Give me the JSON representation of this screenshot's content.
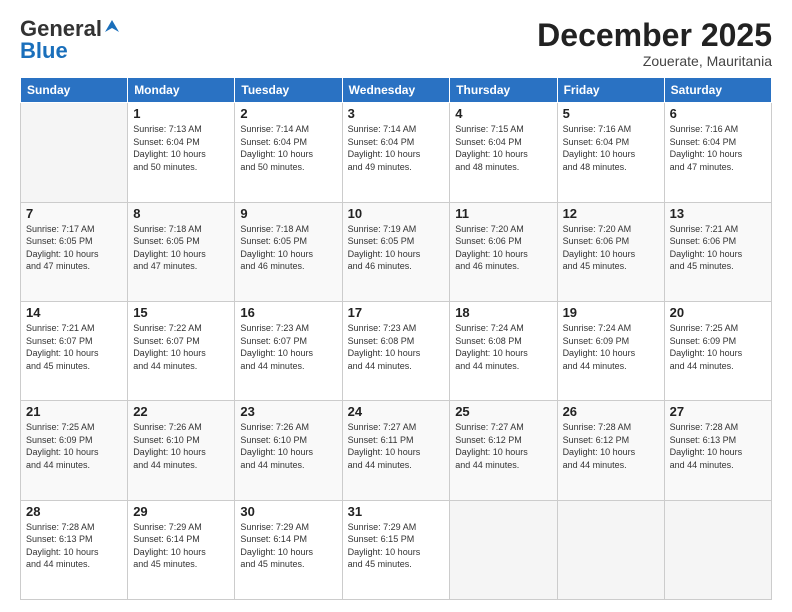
{
  "header": {
    "logo_general": "General",
    "logo_blue": "Blue",
    "month_title": "December 2025",
    "subtitle": "Zouerate, Mauritania"
  },
  "days_of_week": [
    "Sunday",
    "Monday",
    "Tuesday",
    "Wednesday",
    "Thursday",
    "Friday",
    "Saturday"
  ],
  "weeks": [
    [
      {
        "day": "",
        "info": ""
      },
      {
        "day": "1",
        "info": "Sunrise: 7:13 AM\nSunset: 6:04 PM\nDaylight: 10 hours\nand 50 minutes."
      },
      {
        "day": "2",
        "info": "Sunrise: 7:14 AM\nSunset: 6:04 PM\nDaylight: 10 hours\nand 50 minutes."
      },
      {
        "day": "3",
        "info": "Sunrise: 7:14 AM\nSunset: 6:04 PM\nDaylight: 10 hours\nand 49 minutes."
      },
      {
        "day": "4",
        "info": "Sunrise: 7:15 AM\nSunset: 6:04 PM\nDaylight: 10 hours\nand 48 minutes."
      },
      {
        "day": "5",
        "info": "Sunrise: 7:16 AM\nSunset: 6:04 PM\nDaylight: 10 hours\nand 48 minutes."
      },
      {
        "day": "6",
        "info": "Sunrise: 7:16 AM\nSunset: 6:04 PM\nDaylight: 10 hours\nand 47 minutes."
      }
    ],
    [
      {
        "day": "7",
        "info": "Sunrise: 7:17 AM\nSunset: 6:05 PM\nDaylight: 10 hours\nand 47 minutes."
      },
      {
        "day": "8",
        "info": "Sunrise: 7:18 AM\nSunset: 6:05 PM\nDaylight: 10 hours\nand 47 minutes."
      },
      {
        "day": "9",
        "info": "Sunrise: 7:18 AM\nSunset: 6:05 PM\nDaylight: 10 hours\nand 46 minutes."
      },
      {
        "day": "10",
        "info": "Sunrise: 7:19 AM\nSunset: 6:05 PM\nDaylight: 10 hours\nand 46 minutes."
      },
      {
        "day": "11",
        "info": "Sunrise: 7:20 AM\nSunset: 6:06 PM\nDaylight: 10 hours\nand 46 minutes."
      },
      {
        "day": "12",
        "info": "Sunrise: 7:20 AM\nSunset: 6:06 PM\nDaylight: 10 hours\nand 45 minutes."
      },
      {
        "day": "13",
        "info": "Sunrise: 7:21 AM\nSunset: 6:06 PM\nDaylight: 10 hours\nand 45 minutes."
      }
    ],
    [
      {
        "day": "14",
        "info": "Sunrise: 7:21 AM\nSunset: 6:07 PM\nDaylight: 10 hours\nand 45 minutes."
      },
      {
        "day": "15",
        "info": "Sunrise: 7:22 AM\nSunset: 6:07 PM\nDaylight: 10 hours\nand 44 minutes."
      },
      {
        "day": "16",
        "info": "Sunrise: 7:23 AM\nSunset: 6:07 PM\nDaylight: 10 hours\nand 44 minutes."
      },
      {
        "day": "17",
        "info": "Sunrise: 7:23 AM\nSunset: 6:08 PM\nDaylight: 10 hours\nand 44 minutes."
      },
      {
        "day": "18",
        "info": "Sunrise: 7:24 AM\nSunset: 6:08 PM\nDaylight: 10 hours\nand 44 minutes."
      },
      {
        "day": "19",
        "info": "Sunrise: 7:24 AM\nSunset: 6:09 PM\nDaylight: 10 hours\nand 44 minutes."
      },
      {
        "day": "20",
        "info": "Sunrise: 7:25 AM\nSunset: 6:09 PM\nDaylight: 10 hours\nand 44 minutes."
      }
    ],
    [
      {
        "day": "21",
        "info": "Sunrise: 7:25 AM\nSunset: 6:09 PM\nDaylight: 10 hours\nand 44 minutes."
      },
      {
        "day": "22",
        "info": "Sunrise: 7:26 AM\nSunset: 6:10 PM\nDaylight: 10 hours\nand 44 minutes."
      },
      {
        "day": "23",
        "info": "Sunrise: 7:26 AM\nSunset: 6:10 PM\nDaylight: 10 hours\nand 44 minutes."
      },
      {
        "day": "24",
        "info": "Sunrise: 7:27 AM\nSunset: 6:11 PM\nDaylight: 10 hours\nand 44 minutes."
      },
      {
        "day": "25",
        "info": "Sunrise: 7:27 AM\nSunset: 6:12 PM\nDaylight: 10 hours\nand 44 minutes."
      },
      {
        "day": "26",
        "info": "Sunrise: 7:28 AM\nSunset: 6:12 PM\nDaylight: 10 hours\nand 44 minutes."
      },
      {
        "day": "27",
        "info": "Sunrise: 7:28 AM\nSunset: 6:13 PM\nDaylight: 10 hours\nand 44 minutes."
      }
    ],
    [
      {
        "day": "28",
        "info": "Sunrise: 7:28 AM\nSunset: 6:13 PM\nDaylight: 10 hours\nand 44 minutes."
      },
      {
        "day": "29",
        "info": "Sunrise: 7:29 AM\nSunset: 6:14 PM\nDaylight: 10 hours\nand 45 minutes."
      },
      {
        "day": "30",
        "info": "Sunrise: 7:29 AM\nSunset: 6:14 PM\nDaylight: 10 hours\nand 45 minutes."
      },
      {
        "day": "31",
        "info": "Sunrise: 7:29 AM\nSunset: 6:15 PM\nDaylight: 10 hours\nand 45 minutes."
      },
      {
        "day": "",
        "info": ""
      },
      {
        "day": "",
        "info": ""
      },
      {
        "day": "",
        "info": ""
      }
    ]
  ]
}
